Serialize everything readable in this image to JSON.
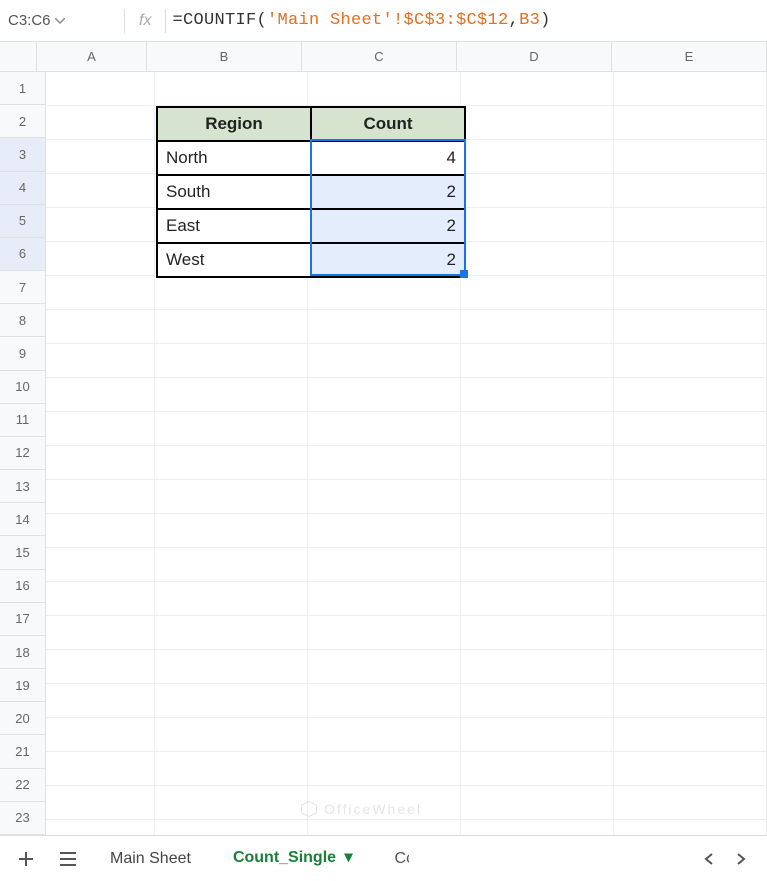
{
  "name_box": "C3:C6",
  "formula": {
    "eq": "=",
    "fn": "COUNTIF",
    "open": "(",
    "ref1": "'Main Sheet'!$C$3:$C$12",
    "comma": ",",
    "ref2": "B3",
    "close": ")"
  },
  "columns": [
    "A",
    "B",
    "C",
    "D",
    "E"
  ],
  "rows": [
    "1",
    "2",
    "3",
    "4",
    "5",
    "6",
    "7",
    "8",
    "9",
    "10",
    "11",
    "12",
    "13",
    "14",
    "15",
    "16",
    "17",
    "18",
    "19",
    "20",
    "21",
    "22",
    "23"
  ],
  "selected_rows": [
    "3",
    "4",
    "5",
    "6"
  ],
  "table": {
    "headers": [
      "Region",
      "Count"
    ],
    "rows": [
      {
        "region": "North",
        "count": "4"
      },
      {
        "region": "South",
        "count": "2"
      },
      {
        "region": "East",
        "count": "2"
      },
      {
        "region": "West",
        "count": "2"
      }
    ]
  },
  "sheet_tabs": {
    "tab1": "Main Sheet",
    "active": "Count_Single",
    "partial": "Co"
  },
  "watermark": "OfficeWheel",
  "chart_data": {
    "type": "table",
    "title": "",
    "columns": [
      "Region",
      "Count"
    ],
    "rows": [
      [
        "North",
        4
      ],
      [
        "South",
        2
      ],
      [
        "East",
        2
      ],
      [
        "West",
        2
      ]
    ]
  }
}
